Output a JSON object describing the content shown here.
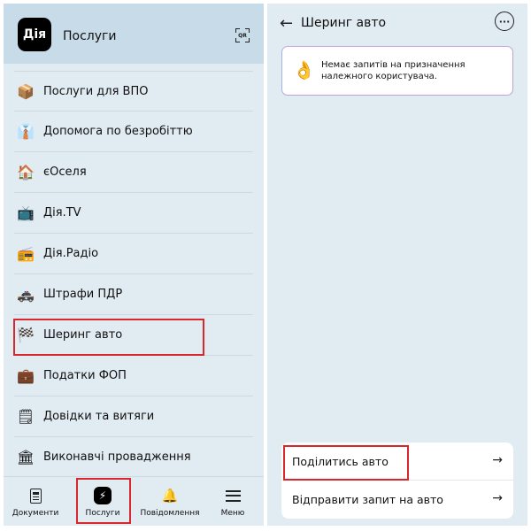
{
  "services_screen": {
    "logo_text": "Дія",
    "title": "Послуги",
    "qr_label": "QR",
    "items": [
      {
        "icon": "box-icon",
        "glyph": "📦",
        "label": "Послуги для ВПО"
      },
      {
        "icon": "necktie-icon",
        "glyph": "👔",
        "label": "Допомога по безробіттю"
      },
      {
        "icon": "house-icon",
        "glyph": "🏠",
        "label": "єОселя"
      },
      {
        "icon": "tv-icon",
        "glyph": "📺",
        "label": "Дія.TV"
      },
      {
        "icon": "radio-icon",
        "glyph": "📻",
        "label": "Дія.Радіо"
      },
      {
        "icon": "police-car-icon",
        "glyph": "🚓",
        "label": "Штрафи ПДР"
      },
      {
        "icon": "checkered-flag-icon",
        "glyph": "🏁",
        "label": "Шеринг авто"
      },
      {
        "icon": "briefcase-icon",
        "glyph": "💼",
        "label": "Податки ФОП"
      },
      {
        "icon": "notepad-icon",
        "glyph": "🗒",
        "label": "Довідки та витяги"
      },
      {
        "icon": "bank-icon",
        "glyph": "🏛",
        "label": "Виконавчі провадження"
      }
    ],
    "tabbar": {
      "documents": "Документи",
      "services": "Послуги",
      "notifications": "Повідомлення",
      "menu": "Меню",
      "services_glyph": "⚡",
      "bell_glyph": "🔔"
    }
  },
  "sharing_screen": {
    "back_glyph": "←",
    "title": "Шеринг авто",
    "more_glyph": "···",
    "notice": {
      "icon": "ok-hand-icon",
      "glyph": "👌",
      "text": "Немає запитів на призначення належного користувача."
    },
    "actions": [
      {
        "label": "Поділитись авто",
        "arrow": "→"
      },
      {
        "label": "Відправити запит на авто",
        "arrow": "→"
      }
    ]
  },
  "colors": {
    "panel_bg": "#e1ebf2",
    "header_bg": "#c8dbe8",
    "highlight": "#d7262c"
  }
}
